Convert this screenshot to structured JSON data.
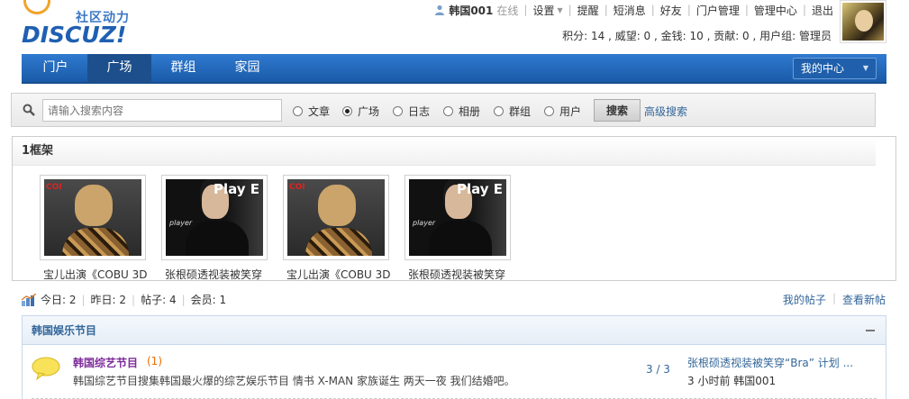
{
  "header": {
    "brand_cn": "社区动力",
    "brand_en": "DISCUZ!",
    "user": {
      "name": "韩国001",
      "status": "在线",
      "links": [
        "设置",
        "提醒",
        "短消息",
        "好友",
        "门户管理",
        "管理中心",
        "退出"
      ]
    },
    "stats": "积分: 14 , 威望: 0 , 金钱: 10 , 贡献: 0 , 用户组: 管理员"
  },
  "nav": {
    "tabs": [
      "门户",
      "广场",
      "群组",
      "家园"
    ],
    "active": "广场",
    "my_center": "我的中心"
  },
  "search": {
    "placeholder": "请输入搜索内容",
    "options": [
      "文章",
      "广场",
      "日志",
      "相册",
      "群组",
      "用户"
    ],
    "selected": "广场",
    "button": "搜索",
    "advanced": "高级搜索"
  },
  "frame": {
    "title": "1框架",
    "items": [
      {
        "caption": "宝儿出演《COBU 3D"
      },
      {
        "caption": "张根硕透视装被笑穿"
      },
      {
        "caption": "宝儿出演《COBU 3D"
      },
      {
        "caption": "张根硕透视装被笑穿"
      }
    ]
  },
  "stats": {
    "today": "今日: 2",
    "yesterday": "昨日: 2",
    "posts": "帖子: 4",
    "members": "会员: 1"
  },
  "quick_links": [
    "我的帖子",
    "查看新帖"
  ],
  "category": {
    "title": "韩国娱乐节目",
    "forums": [
      {
        "name": "韩国综艺节目",
        "count": "(1)",
        "description": "韩国综艺节目搜集韩国最火爆的综艺娱乐节目 情书 X-MAN 家族诞生 两天一夜 我们结婚吧。",
        "ratio": "3 / 3",
        "last_post": "张根硕透视装被笑穿“Bra” 计划 ...",
        "last_meta": "3 小时前 韩国001"
      }
    ]
  },
  "colors": {
    "nav_blue": "#1f5fb3",
    "link": "#336699",
    "forum_name": "#7d2b9a",
    "count": "#f26c00"
  }
}
